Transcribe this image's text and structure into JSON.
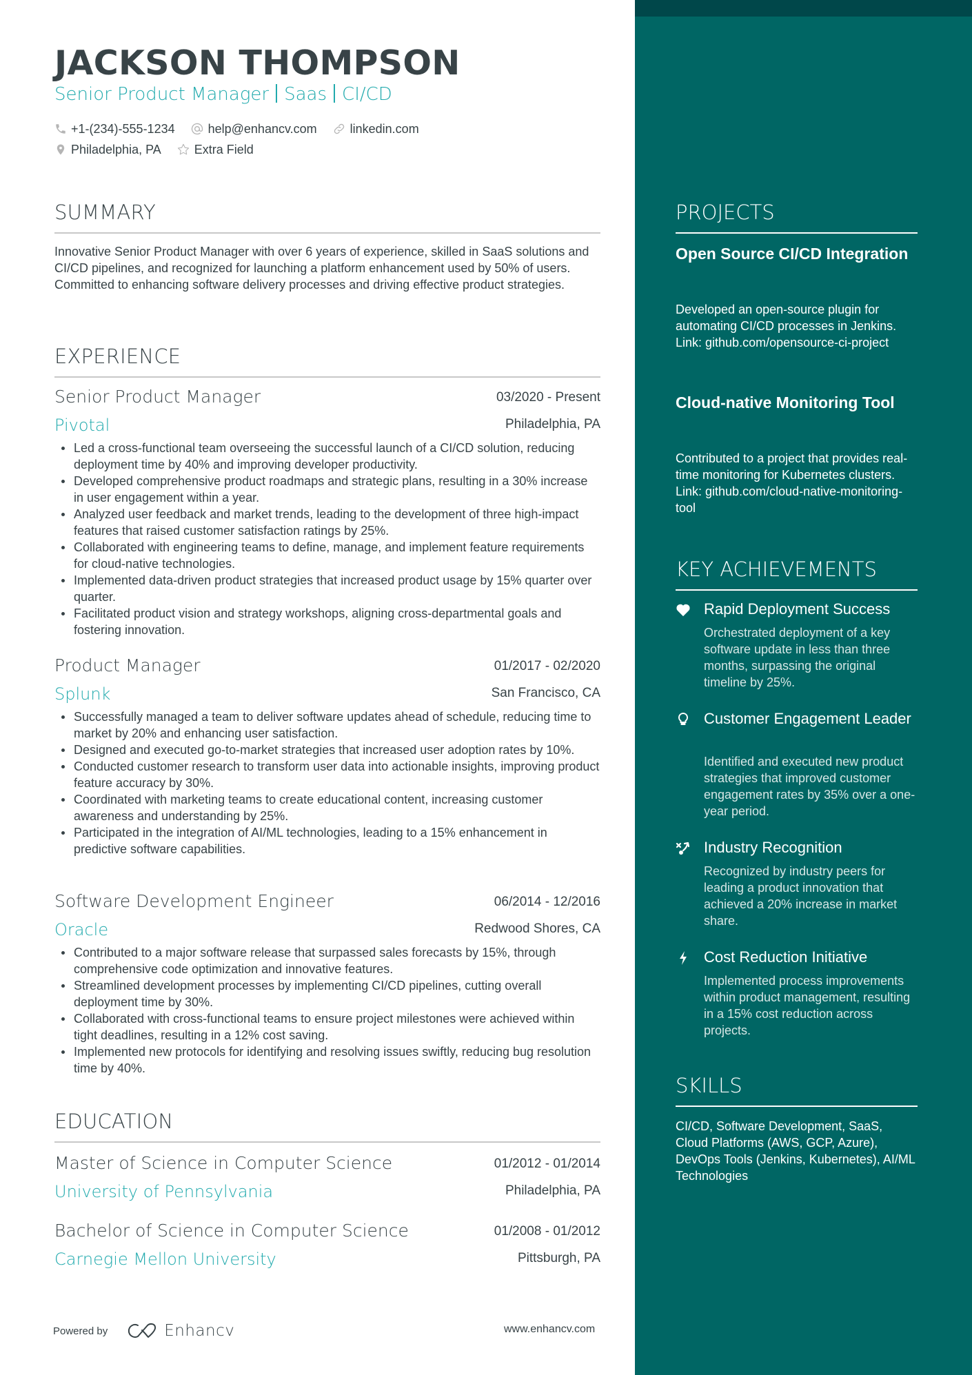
{
  "header": {
    "name": "JACKSON THOMPSON",
    "headline_parts": [
      "Senior Product Manager",
      "Saas",
      "CI/CD"
    ],
    "contacts": {
      "phone": "+1-(234)-555-1234",
      "email": "help@enhancv.com",
      "linkedin": "linkedin.com",
      "location": "Philadelphia, PA",
      "extra": "Extra Field"
    }
  },
  "summary": {
    "title": "SUMMARY",
    "text": "Innovative Senior Product Manager with over 6 years of experience, skilled in SaaS solutions and CI/CD pipelines, and recognized for launching a platform enhancement used by 50% of users. Committed to enhancing software delivery processes and driving effective product strategies."
  },
  "experience": {
    "title": "EXPERIENCE",
    "jobs": [
      {
        "title": "Senior Product Manager",
        "dates": "03/2020 - Present",
        "company": "Pivotal",
        "location": "Philadelphia, PA",
        "bullets": [
          "Led a cross-functional team overseeing the successful launch of a CI/CD solution, reducing deployment time by 40% and improving developer productivity.",
          "Developed comprehensive product roadmaps and strategic plans, resulting in a 30% increase in user engagement within a year.",
          "Analyzed user feedback and market trends, leading to the development of three high-impact features that raised customer satisfaction ratings by 25%.",
          "Collaborated with engineering teams to define, manage, and implement feature requirements for cloud-native technologies.",
          "Implemented data-driven product strategies that increased product usage by 15% quarter over quarter.",
          "Facilitated product vision and strategy workshops, aligning cross-departmental goals and fostering innovation."
        ]
      },
      {
        "title": "Product Manager",
        "dates": "01/2017 - 02/2020",
        "company": "Splunk",
        "location": "San Francisco, CA",
        "bullets": [
          "Successfully managed a team to deliver software updates ahead of schedule, reducing time to market by 20% and enhancing user satisfaction.",
          "Designed and executed go-to-market strategies that increased user adoption rates by 10%.",
          "Conducted customer research to transform user data into actionable insights, improving product feature accuracy by 30%.",
          "Coordinated with marketing teams to create educational content, increasing customer awareness and understanding by 25%.",
          "Participated in the integration of AI/ML technologies, leading to a 15% enhancement in predictive software capabilities."
        ]
      },
      {
        "title": "Software Development Engineer",
        "dates": "06/2014 - 12/2016",
        "company": "Oracle",
        "location": "Redwood Shores, CA",
        "bullets": [
          "Contributed to a major software release that surpassed sales forecasts by 15%, through comprehensive code optimization and innovative features.",
          "Streamlined development processes by implementing CI/CD pipelines, cutting overall deployment time by 30%.",
          "Collaborated with cross-functional teams to ensure project milestones were achieved within tight deadlines, resulting in a 12% cost saving.",
          "Implemented new protocols for identifying and resolving issues swiftly, reducing bug resolution time by 40%."
        ]
      }
    ]
  },
  "education": {
    "title": "EDUCATION",
    "items": [
      {
        "degree": "Master of Science in Computer Science",
        "dates": "01/2012 - 01/2014",
        "school": "University of Pennsylvania",
        "location": "Philadelphia, PA"
      },
      {
        "degree": "Bachelor of Science in Computer Science",
        "dates": "01/2008 - 01/2012",
        "school": "Carnegie Mellon University",
        "location": "Pittsburgh, PA"
      }
    ]
  },
  "footer": {
    "powered_by": "Powered by",
    "brand": "Enhancv",
    "website": "www.enhancv.com"
  },
  "sidebar": {
    "projects": {
      "title": "PROJECTS",
      "items": [
        {
          "title": "Open Source CI/CD Integration",
          "description": "Developed an open-source plugin for automating CI/CD processes in Jenkins. Link: github.com/opensource-ci-project"
        },
        {
          "title": "Cloud-native Monitoring Tool",
          "description": "Contributed to a project that provides real-time monitoring for Kubernetes clusters. Link: github.com/cloud-native-monitoring-tool"
        }
      ]
    },
    "achievements": {
      "title": "KEY ACHIEVEMENTS",
      "items": [
        {
          "icon": "heart-icon",
          "title": "Rapid Deployment Success",
          "description": "Orchestrated deployment of a key software update in less than three months, surpassing the original timeline by 25%."
        },
        {
          "icon": "lightbulb-icon",
          "title": "Customer Engagement Leader",
          "description": "Identified and executed new product strategies that improved customer engagement rates by 35% over a one-year period."
        },
        {
          "icon": "strategy-icon",
          "title": "Industry Recognition",
          "description": "Recognized by industry peers for leading a product innovation that achieved a 20% increase in market share."
        },
        {
          "icon": "lightning-icon",
          "title": "Cost Reduction Initiative",
          "description": "Implemented process improvements within product management, resulting in a 15% cost reduction across projects."
        }
      ]
    },
    "skills": {
      "title": "SKILLS",
      "text": "CI/CD, Software Development, SaaS, Cloud Platforms (AWS, GCP, Azure), DevOps Tools (Jenkins, Kubernetes), AI/ML Technologies"
    }
  },
  "colors": {
    "accent": "#21aaad",
    "text": "#384347",
    "sidebar_bg": "#006664",
    "sidebar_top": "#00474a"
  }
}
